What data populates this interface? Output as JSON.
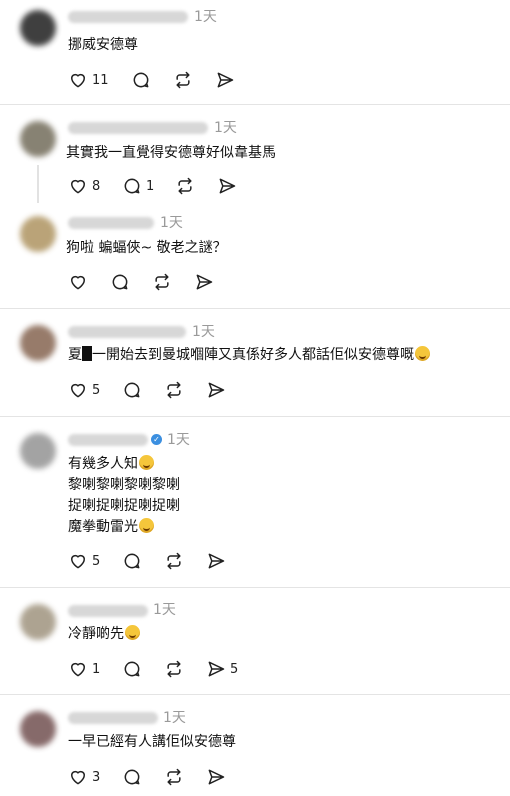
{
  "posts": [
    {
      "time": "1天",
      "lines": [
        "挪威安德尊"
      ],
      "likes": "11",
      "comments": "",
      "reposts": "",
      "shares": "",
      "avatar_color": "#2b2b2b"
    },
    {
      "time": "1天",
      "lines": [
        "其實我一直覺得安德尊好似韋基馬"
      ],
      "likes": "8",
      "comments": "1",
      "reposts": "",
      "shares": "",
      "avatar_color": "#7b7564"
    },
    {
      "time": "1天",
      "lines": [
        "狗啦 蝙蝠俠~ 敬老之謎？"
      ],
      "likes": "",
      "comments": "",
      "reposts": "",
      "shares": "",
      "avatar_color": "#b39a6a"
    },
    {
      "time": "1天",
      "lines": [
        "夏",
        "一開始去到曼城嗰陣又真係好多人都話佢似安德尊嘅"
      ],
      "likes": "5",
      "comments": "",
      "reposts": "",
      "shares": "",
      "avatar_color": "#8c6d5a"
    },
    {
      "time": "1天",
      "lines": [
        "有幾多人知",
        "黎喇黎喇黎喇黎喇",
        "捉喇捉喇捉喇捉喇",
        "魔拳動雷光"
      ],
      "likes": "5",
      "comments": "",
      "reposts": "",
      "shares": "",
      "avatar_color": "#9a9a9a"
    },
    {
      "time": "1天",
      "lines": [
        "冷靜啲先"
      ],
      "likes": "1",
      "comments": "",
      "reposts": "",
      "shares": "5",
      "avatar_color": "#a59a86"
    },
    {
      "time": "1天",
      "lines": [
        "一早已經有人講佢似安德尊"
      ],
      "likes": "3",
      "comments": "",
      "reposts": "",
      "shares": "",
      "avatar_color": "#7a5a5a"
    }
  ],
  "icons": {
    "like": "heart-icon",
    "comment": "comment-bubble-icon",
    "repost": "repost-icon",
    "share": "send-icon"
  },
  "colors": {
    "divider": "#e4e4e4",
    "muted": "#9a9a9a",
    "verified": "#3b8fe0"
  }
}
